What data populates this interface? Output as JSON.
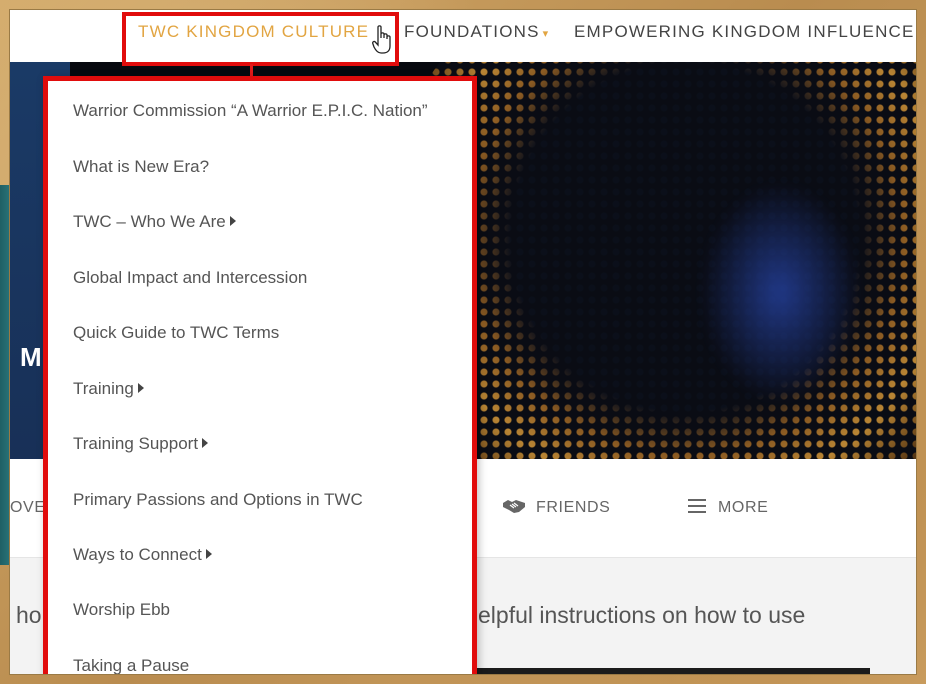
{
  "nav": {
    "items": [
      {
        "label": "TWC KINGDOM CULTURE",
        "active": true
      },
      {
        "label": "FOUNDATIONS",
        "caret": "▾"
      },
      {
        "label": "EMPOWERING KINGDOM INFLUENCE",
        "caret": "▾"
      }
    ]
  },
  "dropdown": {
    "items": [
      {
        "label": "Warrior Commission “A Warrior E.P.I.C. Nation”",
        "submenu": false
      },
      {
        "label": "What is New Era?",
        "submenu": false
      },
      {
        "label": "TWC – Who We Are",
        "submenu": true
      },
      {
        "label": "Global Impact and Intercession",
        "submenu": false
      },
      {
        "label": "Quick Guide to TWC Terms",
        "submenu": false
      },
      {
        "label": "Training",
        "submenu": true
      },
      {
        "label": "Training Support",
        "submenu": true
      },
      {
        "label": "Primary Passions and Options in TWC",
        "submenu": false
      },
      {
        "label": "Ways to Connect",
        "submenu": true
      },
      {
        "label": "Worship Ebb",
        "submenu": false
      },
      {
        "label": "Taking a Pause",
        "submenu": false
      }
    ]
  },
  "hero": {
    "partial_letter": "M"
  },
  "tabs": {
    "partial_left": "OVE",
    "friends": "FRIENDS",
    "more": "MORE"
  },
  "content": {
    "partial_left": "ho",
    "partial_right": "elpful instructions on how to use"
  },
  "colors": {
    "accent": "#e2a542",
    "highlight_red": "#e10c0c"
  },
  "icons": [
    "pointer-hand-icon",
    "handshake-icon",
    "hamburger-icon",
    "caret-down-icon",
    "submenu-arrow-icon"
  ]
}
